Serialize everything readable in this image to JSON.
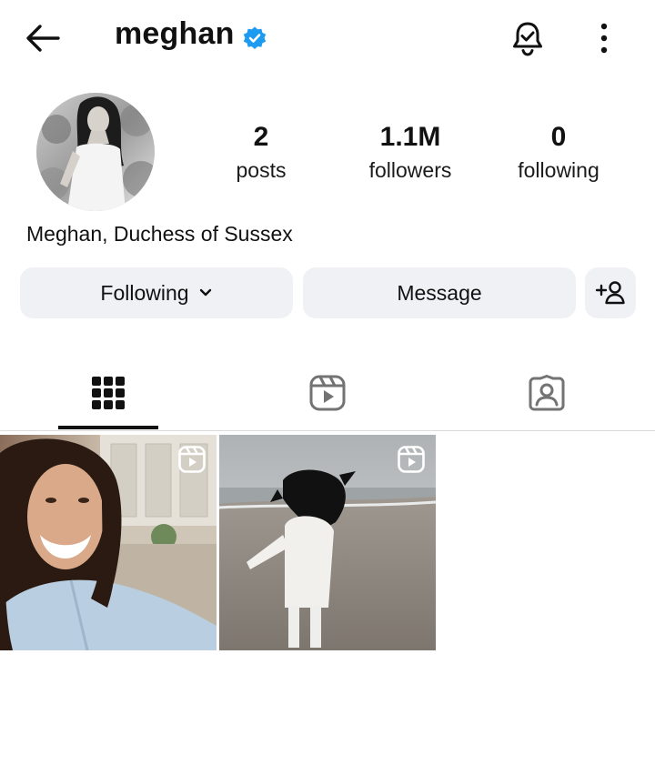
{
  "header": {
    "username": "meghan",
    "verified": true,
    "accent_color": "#1d9bf0"
  },
  "profile": {
    "display_name": "Meghan, Duchess of Sussex",
    "stats": [
      {
        "value": "2",
        "label": "posts"
      },
      {
        "value": "1.1M",
        "label": "followers"
      },
      {
        "value": "0",
        "label": "following"
      }
    ]
  },
  "actions": {
    "following_label": "Following",
    "message_label": "Message"
  },
  "tabs": [
    {
      "icon": "grid-icon",
      "active": true
    },
    {
      "icon": "reels-icon",
      "active": false
    },
    {
      "icon": "tagged-icon",
      "active": false
    }
  ],
  "posts": [
    {
      "type": "reel",
      "badge_icon": "reel-icon"
    },
    {
      "type": "reel",
      "badge_icon": "reel-icon"
    }
  ]
}
